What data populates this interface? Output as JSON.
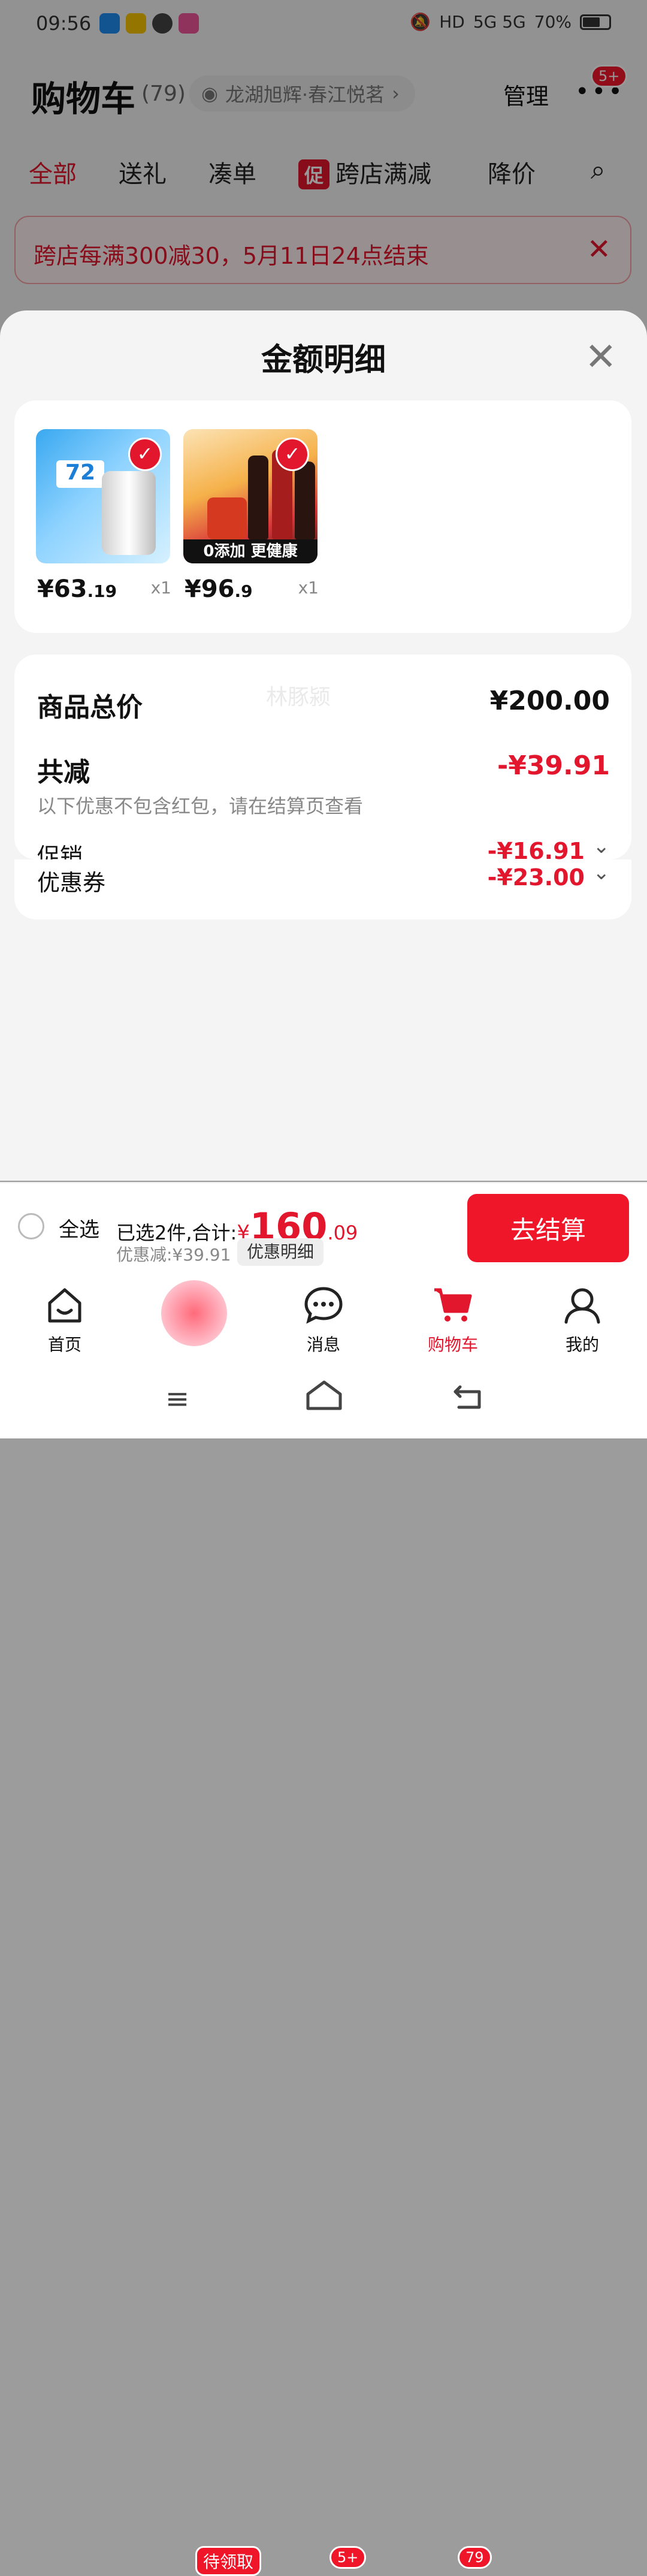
{
  "status_bar": {
    "time": "09:56",
    "signal": "5G 5G",
    "battery": "70%",
    "hd": "HD"
  },
  "header": {
    "title": "购物车",
    "count": "(79)",
    "location": "龙湖旭辉·春江悦茗",
    "manage": "管理",
    "more_badge": "5+"
  },
  "tabs": [
    "全部",
    "送礼",
    "凑单",
    "跨店满减",
    "降价"
  ],
  "promo_tag": "促",
  "banner": {
    "text": "跨店每满300减30，5月11日24点结束"
  },
  "sheet": {
    "title": "金额明细",
    "products": [
      {
        "price_int": "¥63",
        "price_dec": ".19",
        "qty": "x1",
        "img_text": "72"
      },
      {
        "price_int": "¥96",
        "price_dec": ".9",
        "qty": "x1",
        "img_strip": "0添加 更健康"
      }
    ],
    "summary": {
      "total_label": "商品总价",
      "total_value": "¥200.00",
      "watermark": "林豚颍",
      "discount_label": "共减",
      "discount_value": "-¥39.91",
      "discount_note": "以下优惠不包含红包，请在结算页查看",
      "promo_label": "促销",
      "promo_value": "-¥16.91",
      "coupon_label": "优惠券",
      "coupon_value": "-¥23.00"
    }
  },
  "checkout": {
    "select_all": "全选",
    "selected_text": "已选2件,合计:",
    "currency": "¥",
    "total_int": "160",
    "total_dec": ".09",
    "discount_text": "优惠减:¥39.91",
    "detail_button": "优惠明细",
    "pay_button": "去结算"
  },
  "nav": {
    "home": "首页",
    "coupon_badge": "待领取",
    "messages": "消息",
    "messages_badge": "5+",
    "cart": "购物车",
    "cart_badge": "79",
    "mine": "我的"
  },
  "colors": {
    "accent": "#e2162d",
    "pay": "#f0162a"
  }
}
